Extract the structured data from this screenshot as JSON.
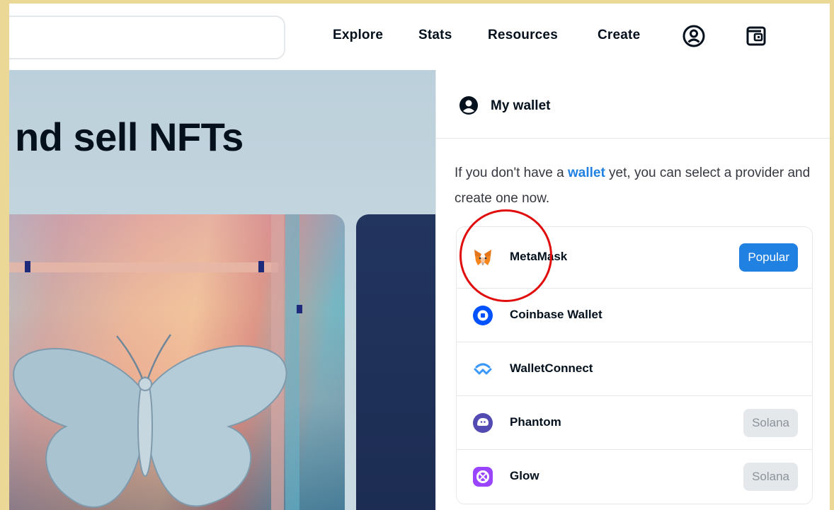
{
  "header": {
    "search_placeholder": "",
    "nav": [
      "Explore",
      "Stats",
      "Resources",
      "Create"
    ],
    "icons": [
      "account-icon",
      "wallet-icon"
    ]
  },
  "hero": {
    "title": "nd sell NFTs"
  },
  "wallet_panel": {
    "title": "My wallet",
    "description_before": "If you don't have a ",
    "description_link": "wallet",
    "description_after": " yet, you can select a provider and create one now.",
    "providers": [
      {
        "name": "MetaMask",
        "badge": "Popular",
        "icon": "metamask-fox-icon"
      },
      {
        "name": "Coinbase Wallet",
        "badge": "",
        "icon": "coinbase-icon"
      },
      {
        "name": "WalletConnect",
        "badge": "",
        "icon": "walletconnect-icon"
      },
      {
        "name": "Phantom",
        "badge": "Solana",
        "icon": "phantom-icon"
      },
      {
        "name": "Glow",
        "badge": "Solana",
        "icon": "glow-icon"
      }
    ]
  },
  "colors": {
    "accent": "#2081e2",
    "annotation": "#e10c0c",
    "border_frame": "#ecd896"
  }
}
